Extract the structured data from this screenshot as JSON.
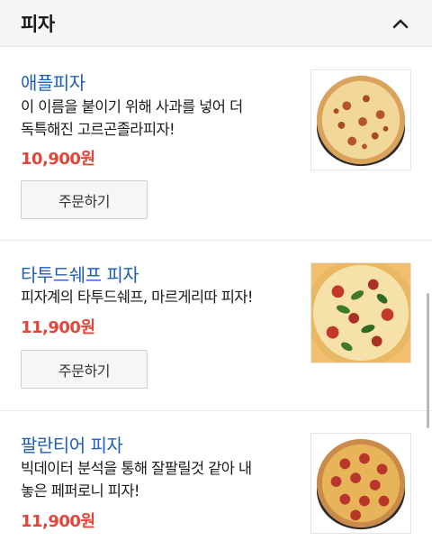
{
  "section": {
    "title": "피자",
    "collapse_icon": "chevron-up-icon"
  },
  "items": [
    {
      "name": "애플피자",
      "desc_line1": "이 이름을 붙이기 위해 사과를 넣어 더",
      "desc_line2": "독특해진 고르곤졸라피자!",
      "price": "10,900원",
      "order_label": "주문하기"
    },
    {
      "name": "타투드쉐프 피자",
      "desc_line1": "피자계의 타투드쉐프, 마르게리따 피자!",
      "desc_line2": "",
      "price": "11,900원",
      "order_label": "주문하기"
    },
    {
      "name": "팔란티어 피자",
      "desc_line1": "빅데이터 분석을 통해 잘팔릴것 같아 내",
      "desc_line2": "놓은 페퍼로니 피자!",
      "price": "11,900원",
      "order_label": ""
    }
  ],
  "colors": {
    "name": "#1f5fb8",
    "price": "#e0473a",
    "header_bg": "#f5f5f5"
  }
}
